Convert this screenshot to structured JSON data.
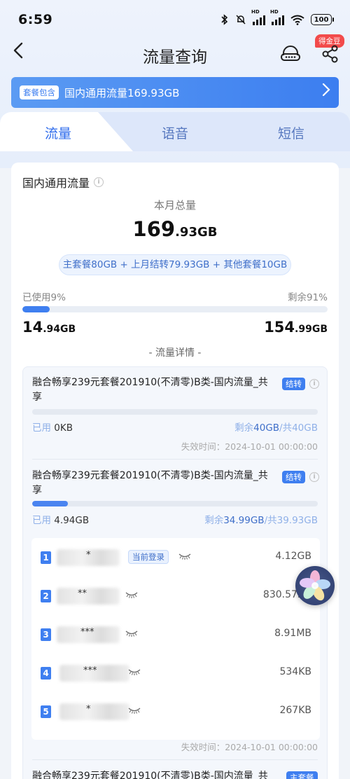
{
  "status_bar": {
    "time": "6:59",
    "battery": "100",
    "hd": "HD"
  },
  "nav": {
    "title": "流量查询",
    "badge": "得金豆"
  },
  "banner": {
    "tag": "套餐包含",
    "text": "国内通用流量169.93GB"
  },
  "tabs": [
    "流量",
    "语音",
    "短信"
  ],
  "summary": {
    "section_title": "国内通用流量",
    "total_label": "本月总量",
    "total_big": "169",
    "total_small": ".93GB",
    "composition": "主套餐80GB + 上月结转79.93GB + 其他套餐10GB",
    "used_label": "已使用9%",
    "remain_label": "剩余91%",
    "used_percent": 9,
    "used_big": "14",
    "used_small": ".94GB",
    "remain_big": "154",
    "remain_small": ".99GB",
    "detail_header": "- 流量详情 -"
  },
  "packages": [
    {
      "name": "融合畅享239元套餐201910(不清零)B类-国内流量_共享",
      "tag": "结转",
      "used_label": "已用",
      "used_value": "0KB",
      "remain_label": "剩余",
      "remain_value": "40GB",
      "total_value": "/共40GB",
      "used_fraction": 0,
      "expire": "失效时间：2024-10-01 00:00:00"
    },
    {
      "name": "融合畅享239元套餐201910(不清零)B类-国内流量_共享",
      "tag": "结转",
      "used_label": "已用",
      "used_value": "4.94GB",
      "remain_label": "剩余",
      "remain_value": "34.99GB",
      "total_value": "/共39.93GB",
      "used_fraction": 0.124,
      "expire": "失效时间：2024-10-01 00:00:00"
    },
    {
      "name": "融合畅享239元套餐201910(不清零)B类-国内流量_共",
      "tag": "主套餐"
    }
  ],
  "users": [
    {
      "num": "1",
      "mask": "*",
      "login_tag": "当前登录",
      "value": "4.12GB"
    },
    {
      "num": "2",
      "mask": "**",
      "value": "830.57M"
    },
    {
      "num": "3",
      "mask": "***",
      "value": "8.91MB"
    },
    {
      "num": "4",
      "mask": "***",
      "value": "534KB"
    },
    {
      "num": "5",
      "mask": "*",
      "value": "267KB"
    }
  ]
}
